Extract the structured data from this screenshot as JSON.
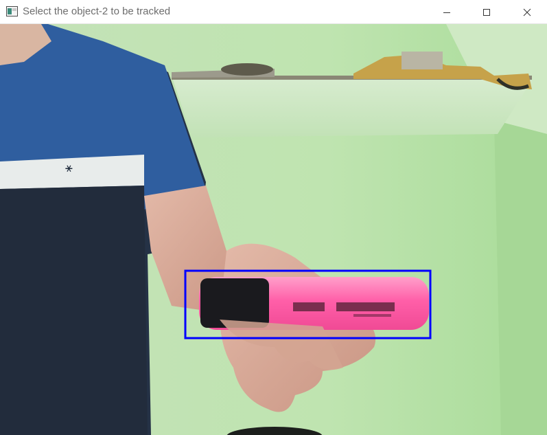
{
  "window": {
    "title": "Select the object-2 to be tracked",
    "icon": "app-window-icon",
    "controls": [
      "minimize-icon",
      "maximize-icon",
      "close-icon"
    ]
  },
  "frame": {
    "content": "webcam-frame",
    "selection": {
      "color": "#0000ff"
    }
  }
}
